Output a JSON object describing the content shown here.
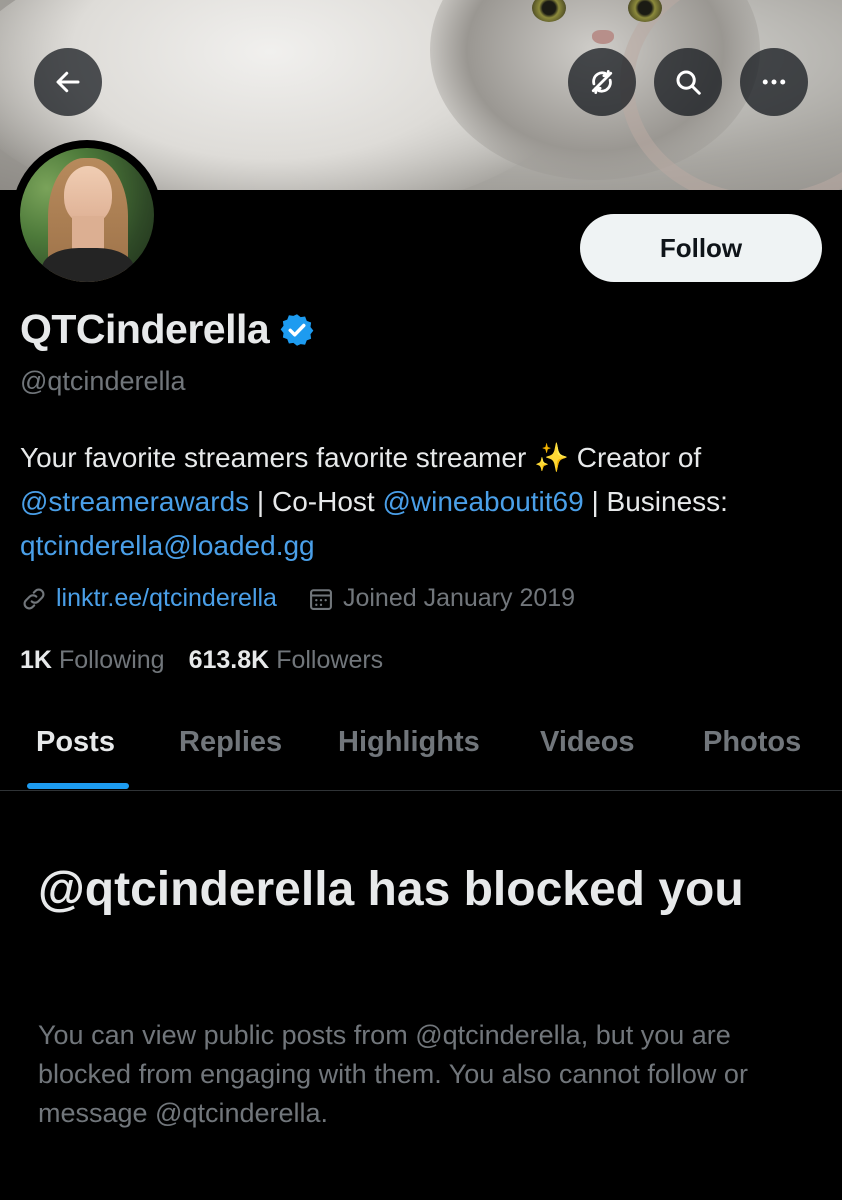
{
  "header": {
    "back_icon": "arrow-left-icon",
    "translate_icon": "refresh-crossed-icon",
    "search_icon": "search-icon",
    "more_icon": "more-horizontal-icon"
  },
  "profile": {
    "display_name": "QTCinderella",
    "verified": true,
    "handle": "@qtcinderella",
    "follow_label": "Follow",
    "bio": {
      "text_1": "Your favorite streamers favorite streamer ",
      "sparkle": "✨",
      "text_2": " Creator of ",
      "mention_1": "@streamerawards",
      "text_3": " | Co-Host ",
      "mention_2": "@wineaboutit69",
      "text_4": " | Business: ",
      "email": "qtcinderella@loaded.gg"
    },
    "website": "linktr.ee/qtcinderella",
    "joined": "Joined January 2019",
    "following_count": "1K",
    "following_label": "Following",
    "followers_count": "613.8K",
    "followers_label": "Followers"
  },
  "tabs": [
    {
      "label": "Posts",
      "active": true
    },
    {
      "label": "Replies",
      "active": false
    },
    {
      "label": "Highlights",
      "active": false
    },
    {
      "label": "Videos",
      "active": false
    },
    {
      "label": "Photos",
      "active": false
    }
  ],
  "blocked": {
    "title": "@qtcinderella has blocked you",
    "message": "You can view public posts from @qtcinderella, but you are blocked from engaging with them. You also cannot follow or message @qtcinderella."
  },
  "colors": {
    "accent": "#1d9bf0",
    "link": "#4a9fe8",
    "muted": "#71767b",
    "background": "#000000"
  }
}
